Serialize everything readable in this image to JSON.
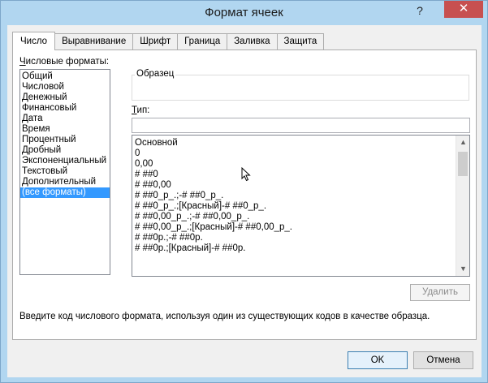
{
  "window": {
    "title": "Формат ячеек",
    "help_label": "?",
    "close_label": "✕"
  },
  "tabs": [
    {
      "label": "Число"
    },
    {
      "label": "Выравнивание"
    },
    {
      "label": "Шрифт"
    },
    {
      "label": "Граница"
    },
    {
      "label": "Заливка"
    },
    {
      "label": "Защита"
    }
  ],
  "categories": {
    "label_first": "Ч",
    "label_rest": "исловые форматы:",
    "items": [
      "Общий",
      "Числовой",
      "Денежный",
      "Финансовый",
      "Дата",
      "Время",
      "Процентный",
      "Дробный",
      "Экспоненциальный",
      "Текстовый",
      "Дополнительный",
      "(все форматы)"
    ],
    "selected": "(все форматы)"
  },
  "sample": {
    "label": "Образец",
    "value": ""
  },
  "type": {
    "label_first": "Т",
    "label_rest": "ип:",
    "value": ""
  },
  "formats": [
    "Основной",
    "0",
    "0,00",
    "# ##0",
    "# ##0,00",
    "# ##0_р_.;-# ##0_р_.",
    "# ##0_р_.;[Красный]-# ##0_р_.",
    "# ##0,00_р_.;-# ##0,00_р_.",
    "# ##0,00_р_.;[Красный]-# ##0,00_р_.",
    "# ##0р.;-# ##0р.",
    "# ##0р.;[Красный]-# ##0р."
  ],
  "buttons": {
    "delete": "Удалить",
    "ok": "OK",
    "cancel": "Отмена"
  },
  "hint": "Введите код числового формата, используя один из существующих кодов в качестве образца.",
  "colors": {
    "selection": "#3399ff",
    "close": "#c75050",
    "titlebar": "#b1d6f0"
  }
}
